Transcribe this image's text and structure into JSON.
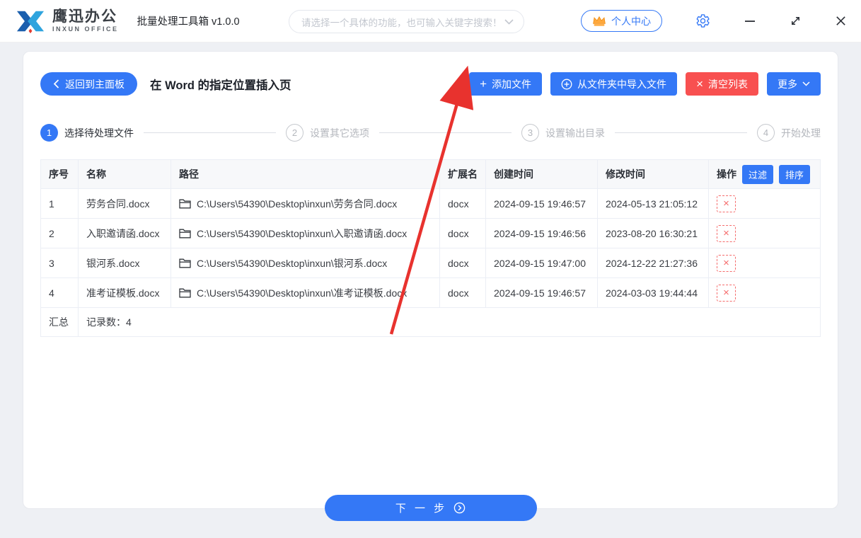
{
  "window": {
    "brand_cn": "鹰迅办公",
    "brand_en": "INXUN OFFICE",
    "app_title": "批量处理工具箱 v1.0.0",
    "search_placeholder": "请选择一个具体的功能，也可输入关键字搜索！",
    "user_center_label": "个人中心"
  },
  "toolbar": {
    "back_label": "返回到主面板",
    "page_title": "在 Word 的指定位置插入页",
    "add_files_label": "添加文件",
    "import_folder_label": "从文件夹中导入文件",
    "clear_list_label": "清空列表",
    "more_label": "更多"
  },
  "steps": [
    {
      "num": "1",
      "label": "选择待处理文件"
    },
    {
      "num": "2",
      "label": "设置其它选项"
    },
    {
      "num": "3",
      "label": "设置输出目录"
    },
    {
      "num": "4",
      "label": "开始处理"
    }
  ],
  "table": {
    "headers": [
      "序号",
      "名称",
      "路径",
      "扩展名",
      "创建时间",
      "修改时间",
      "操作"
    ],
    "filter_label": "过滤",
    "sort_label": "排序",
    "rows": [
      {
        "index": "1",
        "name": "劳务合同.docx",
        "path": "C:\\Users\\54390\\Desktop\\inxun\\劳务合同.docx",
        "ext": "docx",
        "created": "2024-09-15 19:46:57",
        "modified": "2024-05-13 21:05:12"
      },
      {
        "index": "2",
        "name": "入职邀请函.docx",
        "path": "C:\\Users\\54390\\Desktop\\inxun\\入职邀请函.docx",
        "ext": "docx",
        "created": "2024-09-15 19:46:56",
        "modified": "2023-08-20 16:30:21"
      },
      {
        "index": "3",
        "name": "银河系.docx",
        "path": "C:\\Users\\54390\\Desktop\\inxun\\银河系.docx",
        "ext": "docx",
        "created": "2024-09-15 19:47:00",
        "modified": "2024-12-22 21:27:36"
      },
      {
        "index": "4",
        "name": "准考证模板.docx",
        "path": "C:\\Users\\54390\\Desktop\\inxun\\准考证模板.docx",
        "ext": "docx",
        "created": "2024-09-15 19:46:57",
        "modified": "2024-03-03 19:44:44"
      }
    ],
    "summary_label": "汇总",
    "summary_text": "记录数：4",
    "delete_glyph": "×"
  },
  "footer": {
    "next_label": "下 一 步"
  },
  "icons": {
    "plus": "+",
    "close_x": "×"
  },
  "colors": {
    "accent_blue": "#3478f6",
    "danger_red": "#f85050",
    "crown_orange": "#ffa93d",
    "arrow_red": "#e8322e",
    "placeholder_gray": "#c3c7cf"
  }
}
